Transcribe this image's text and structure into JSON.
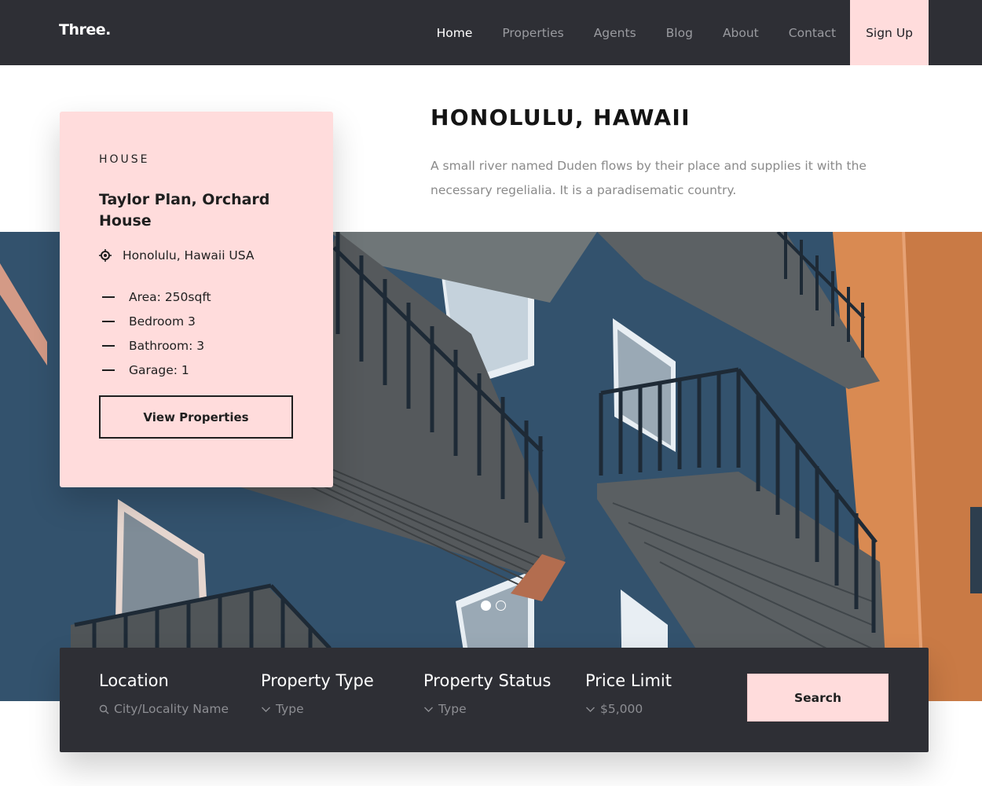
{
  "brand": {
    "logo": "Three."
  },
  "nav": {
    "items": [
      {
        "label": "Home",
        "active": true
      },
      {
        "label": "Properties"
      },
      {
        "label": "Agents"
      },
      {
        "label": "Blog"
      },
      {
        "label": "About"
      },
      {
        "label": "Contact"
      }
    ],
    "signup": "Sign Up"
  },
  "header": {
    "title": "HONOLULU, HAWAII",
    "description": "A small river named Duden flows by their place and supplies it with the necessary regelialia. It is a paradisematic country."
  },
  "card": {
    "type": "HOUSE",
    "title": "Taylor Plan, Orchard House",
    "location": "Honolulu, Hawaii USA",
    "features": [
      "Area: 250sqft",
      "Bedroom 3",
      "Bathroom: 3",
      "Garage: 1"
    ],
    "button": "View Properties"
  },
  "slider": {
    "slides": 2,
    "active_index": 0
  },
  "search": {
    "fields": [
      {
        "label": "Location",
        "placeholder": "City/Locality Name",
        "icon": "search-icon"
      },
      {
        "label": "Property Type",
        "placeholder": "Type",
        "icon": "chevron-down-icon"
      },
      {
        "label": "Property Status",
        "placeholder": "Type",
        "icon": "chevron-down-icon"
      },
      {
        "label": "Price Limit",
        "placeholder": "$5,000",
        "icon": "chevron-down-icon"
      }
    ],
    "button": "Search"
  },
  "colors": {
    "dark": "#2e2f35",
    "accent": "#ffdcdc",
    "muted_text": "#8a8a8a"
  }
}
